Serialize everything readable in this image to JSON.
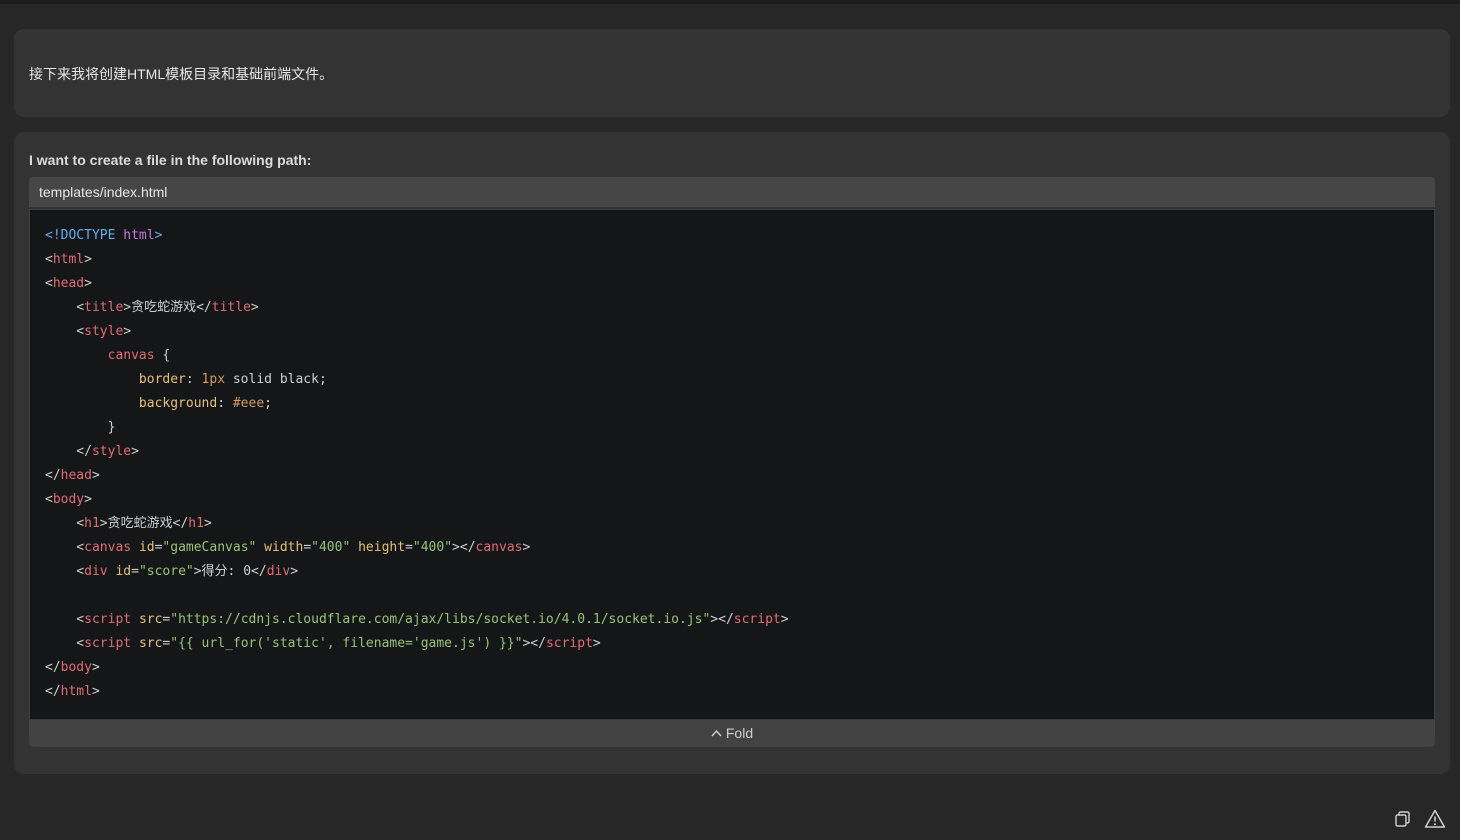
{
  "message": {
    "text": "接下来我将创建HTML模板目录和基础前端文件。"
  },
  "file_card": {
    "heading": "I want to create a file in the following path:",
    "path": "templates/index.html",
    "fold_label": "Fold",
    "fold_icon": "chevron-up-icon",
    "code_lines": [
      [
        {
          "t": "<!DOCTYPE ",
          "c": "#61afef"
        },
        {
          "t": "html",
          "c": "#c678dd"
        },
        {
          "t": ">",
          "c": "#61afef"
        }
      ],
      [
        {
          "t": "<",
          "c": "#cfcfcf"
        },
        {
          "t": "html",
          "c": "#e06c75"
        },
        {
          "t": ">",
          "c": "#cfcfcf"
        }
      ],
      [
        {
          "t": "<",
          "c": "#cfcfcf"
        },
        {
          "t": "head",
          "c": "#e06c75"
        },
        {
          "t": ">",
          "c": "#cfcfcf"
        }
      ],
      [
        {
          "t": "    <",
          "c": "#cfcfcf"
        },
        {
          "t": "title",
          "c": "#e06c75"
        },
        {
          "t": ">贪吃蛇游戏</",
          "c": "#cfcfcf"
        },
        {
          "t": "title",
          "c": "#e06c75"
        },
        {
          "t": ">",
          "c": "#cfcfcf"
        }
      ],
      [
        {
          "t": "    <",
          "c": "#cfcfcf"
        },
        {
          "t": "style",
          "c": "#e06c75"
        },
        {
          "t": ">",
          "c": "#cfcfcf"
        }
      ],
      [
        {
          "t": "        ",
          "c": "#cfcfcf"
        },
        {
          "t": "canvas",
          "c": "#e06c75"
        },
        {
          "t": " {",
          "c": "#cfcfcf"
        }
      ],
      [
        {
          "t": "            ",
          "c": "#cfcfcf"
        },
        {
          "t": "border",
          "c": "#e5c07b"
        },
        {
          "t": ": ",
          "c": "#cfcfcf"
        },
        {
          "t": "1px",
          "c": "#d19a66"
        },
        {
          "t": " solid black;",
          "c": "#cfcfcf"
        }
      ],
      [
        {
          "t": "            ",
          "c": "#cfcfcf"
        },
        {
          "t": "background",
          "c": "#e5c07b"
        },
        {
          "t": ": ",
          "c": "#cfcfcf"
        },
        {
          "t": "#eee",
          "c": "#d19a66"
        },
        {
          "t": ";",
          "c": "#cfcfcf"
        }
      ],
      [
        {
          "t": "        }",
          "c": "#cfcfcf"
        }
      ],
      [
        {
          "t": "    </",
          "c": "#cfcfcf"
        },
        {
          "t": "style",
          "c": "#e06c75"
        },
        {
          "t": ">",
          "c": "#cfcfcf"
        }
      ],
      [
        {
          "t": "</",
          "c": "#cfcfcf"
        },
        {
          "t": "head",
          "c": "#e06c75"
        },
        {
          "t": ">",
          "c": "#cfcfcf"
        }
      ],
      [
        {
          "t": "<",
          "c": "#cfcfcf"
        },
        {
          "t": "body",
          "c": "#e06c75"
        },
        {
          "t": ">",
          "c": "#cfcfcf"
        }
      ],
      [
        {
          "t": "    <",
          "c": "#cfcfcf"
        },
        {
          "t": "h1",
          "c": "#e06c75"
        },
        {
          "t": ">贪吃蛇游戏</",
          "c": "#cfcfcf"
        },
        {
          "t": "h1",
          "c": "#e06c75"
        },
        {
          "t": ">",
          "c": "#cfcfcf"
        }
      ],
      [
        {
          "t": "    <",
          "c": "#cfcfcf"
        },
        {
          "t": "canvas",
          "c": "#e06c75"
        },
        {
          "t": " ",
          "c": "#cfcfcf"
        },
        {
          "t": "id",
          "c": "#e5c07b"
        },
        {
          "t": "=",
          "c": "#cfcfcf"
        },
        {
          "t": "\"gameCanvas\"",
          "c": "#98c379"
        },
        {
          "t": " ",
          "c": "#cfcfcf"
        },
        {
          "t": "width",
          "c": "#e5c07b"
        },
        {
          "t": "=",
          "c": "#cfcfcf"
        },
        {
          "t": "\"400\"",
          "c": "#98c379"
        },
        {
          "t": " ",
          "c": "#cfcfcf"
        },
        {
          "t": "height",
          "c": "#e5c07b"
        },
        {
          "t": "=",
          "c": "#cfcfcf"
        },
        {
          "t": "\"400\"",
          "c": "#98c379"
        },
        {
          "t": "></",
          "c": "#cfcfcf"
        },
        {
          "t": "canvas",
          "c": "#e06c75"
        },
        {
          "t": ">",
          "c": "#cfcfcf"
        }
      ],
      [
        {
          "t": "    <",
          "c": "#cfcfcf"
        },
        {
          "t": "div",
          "c": "#e06c75"
        },
        {
          "t": " ",
          "c": "#cfcfcf"
        },
        {
          "t": "id",
          "c": "#e5c07b"
        },
        {
          "t": "=",
          "c": "#cfcfcf"
        },
        {
          "t": "\"score\"",
          "c": "#98c379"
        },
        {
          "t": ">得分: 0</",
          "c": "#cfcfcf"
        },
        {
          "t": "div",
          "c": "#e06c75"
        },
        {
          "t": ">",
          "c": "#cfcfcf"
        }
      ],
      [
        {
          "t": "",
          "c": "#cfcfcf"
        }
      ],
      [
        {
          "t": "    <",
          "c": "#cfcfcf"
        },
        {
          "t": "script",
          "c": "#e06c75"
        },
        {
          "t": " ",
          "c": "#cfcfcf"
        },
        {
          "t": "src",
          "c": "#e5c07b"
        },
        {
          "t": "=",
          "c": "#cfcfcf"
        },
        {
          "t": "\"https://cdnjs.cloudflare.com/ajax/libs/socket.io/4.0.1/socket.io.js\"",
          "c": "#98c379"
        },
        {
          "t": "></",
          "c": "#cfcfcf"
        },
        {
          "t": "script",
          "c": "#e06c75"
        },
        {
          "t": ">",
          "c": "#cfcfcf"
        }
      ],
      [
        {
          "t": "    <",
          "c": "#cfcfcf"
        },
        {
          "t": "script",
          "c": "#e06c75"
        },
        {
          "t": " ",
          "c": "#cfcfcf"
        },
        {
          "t": "src",
          "c": "#e5c07b"
        },
        {
          "t": "=",
          "c": "#cfcfcf"
        },
        {
          "t": "\"{{ url_for('static', filename='game.js') }}\"",
          "c": "#98c379"
        },
        {
          "t": "></",
          "c": "#cfcfcf"
        },
        {
          "t": "script",
          "c": "#e06c75"
        },
        {
          "t": ">",
          "c": "#cfcfcf"
        }
      ],
      [
        {
          "t": "</",
          "c": "#cfcfcf"
        },
        {
          "t": "body",
          "c": "#e06c75"
        },
        {
          "t": ">",
          "c": "#cfcfcf"
        }
      ],
      [
        {
          "t": "</",
          "c": "#cfcfcf"
        },
        {
          "t": "html",
          "c": "#e06c75"
        },
        {
          "t": ">",
          "c": "#cfcfcf"
        }
      ]
    ]
  },
  "bottom_icons": [
    {
      "name": "copy-icon"
    },
    {
      "name": "warning-icon"
    }
  ],
  "colors": {
    "background": "#272727",
    "card": "#333333",
    "code_background": "#151618",
    "path_bar": "#464646",
    "fold_bar": "#424242",
    "tag": "#e06c75",
    "attribute": "#e5c07b",
    "string": "#98c379",
    "number": "#d19a66",
    "doctype": "#61afef",
    "doctype_keyword": "#c678dd"
  }
}
